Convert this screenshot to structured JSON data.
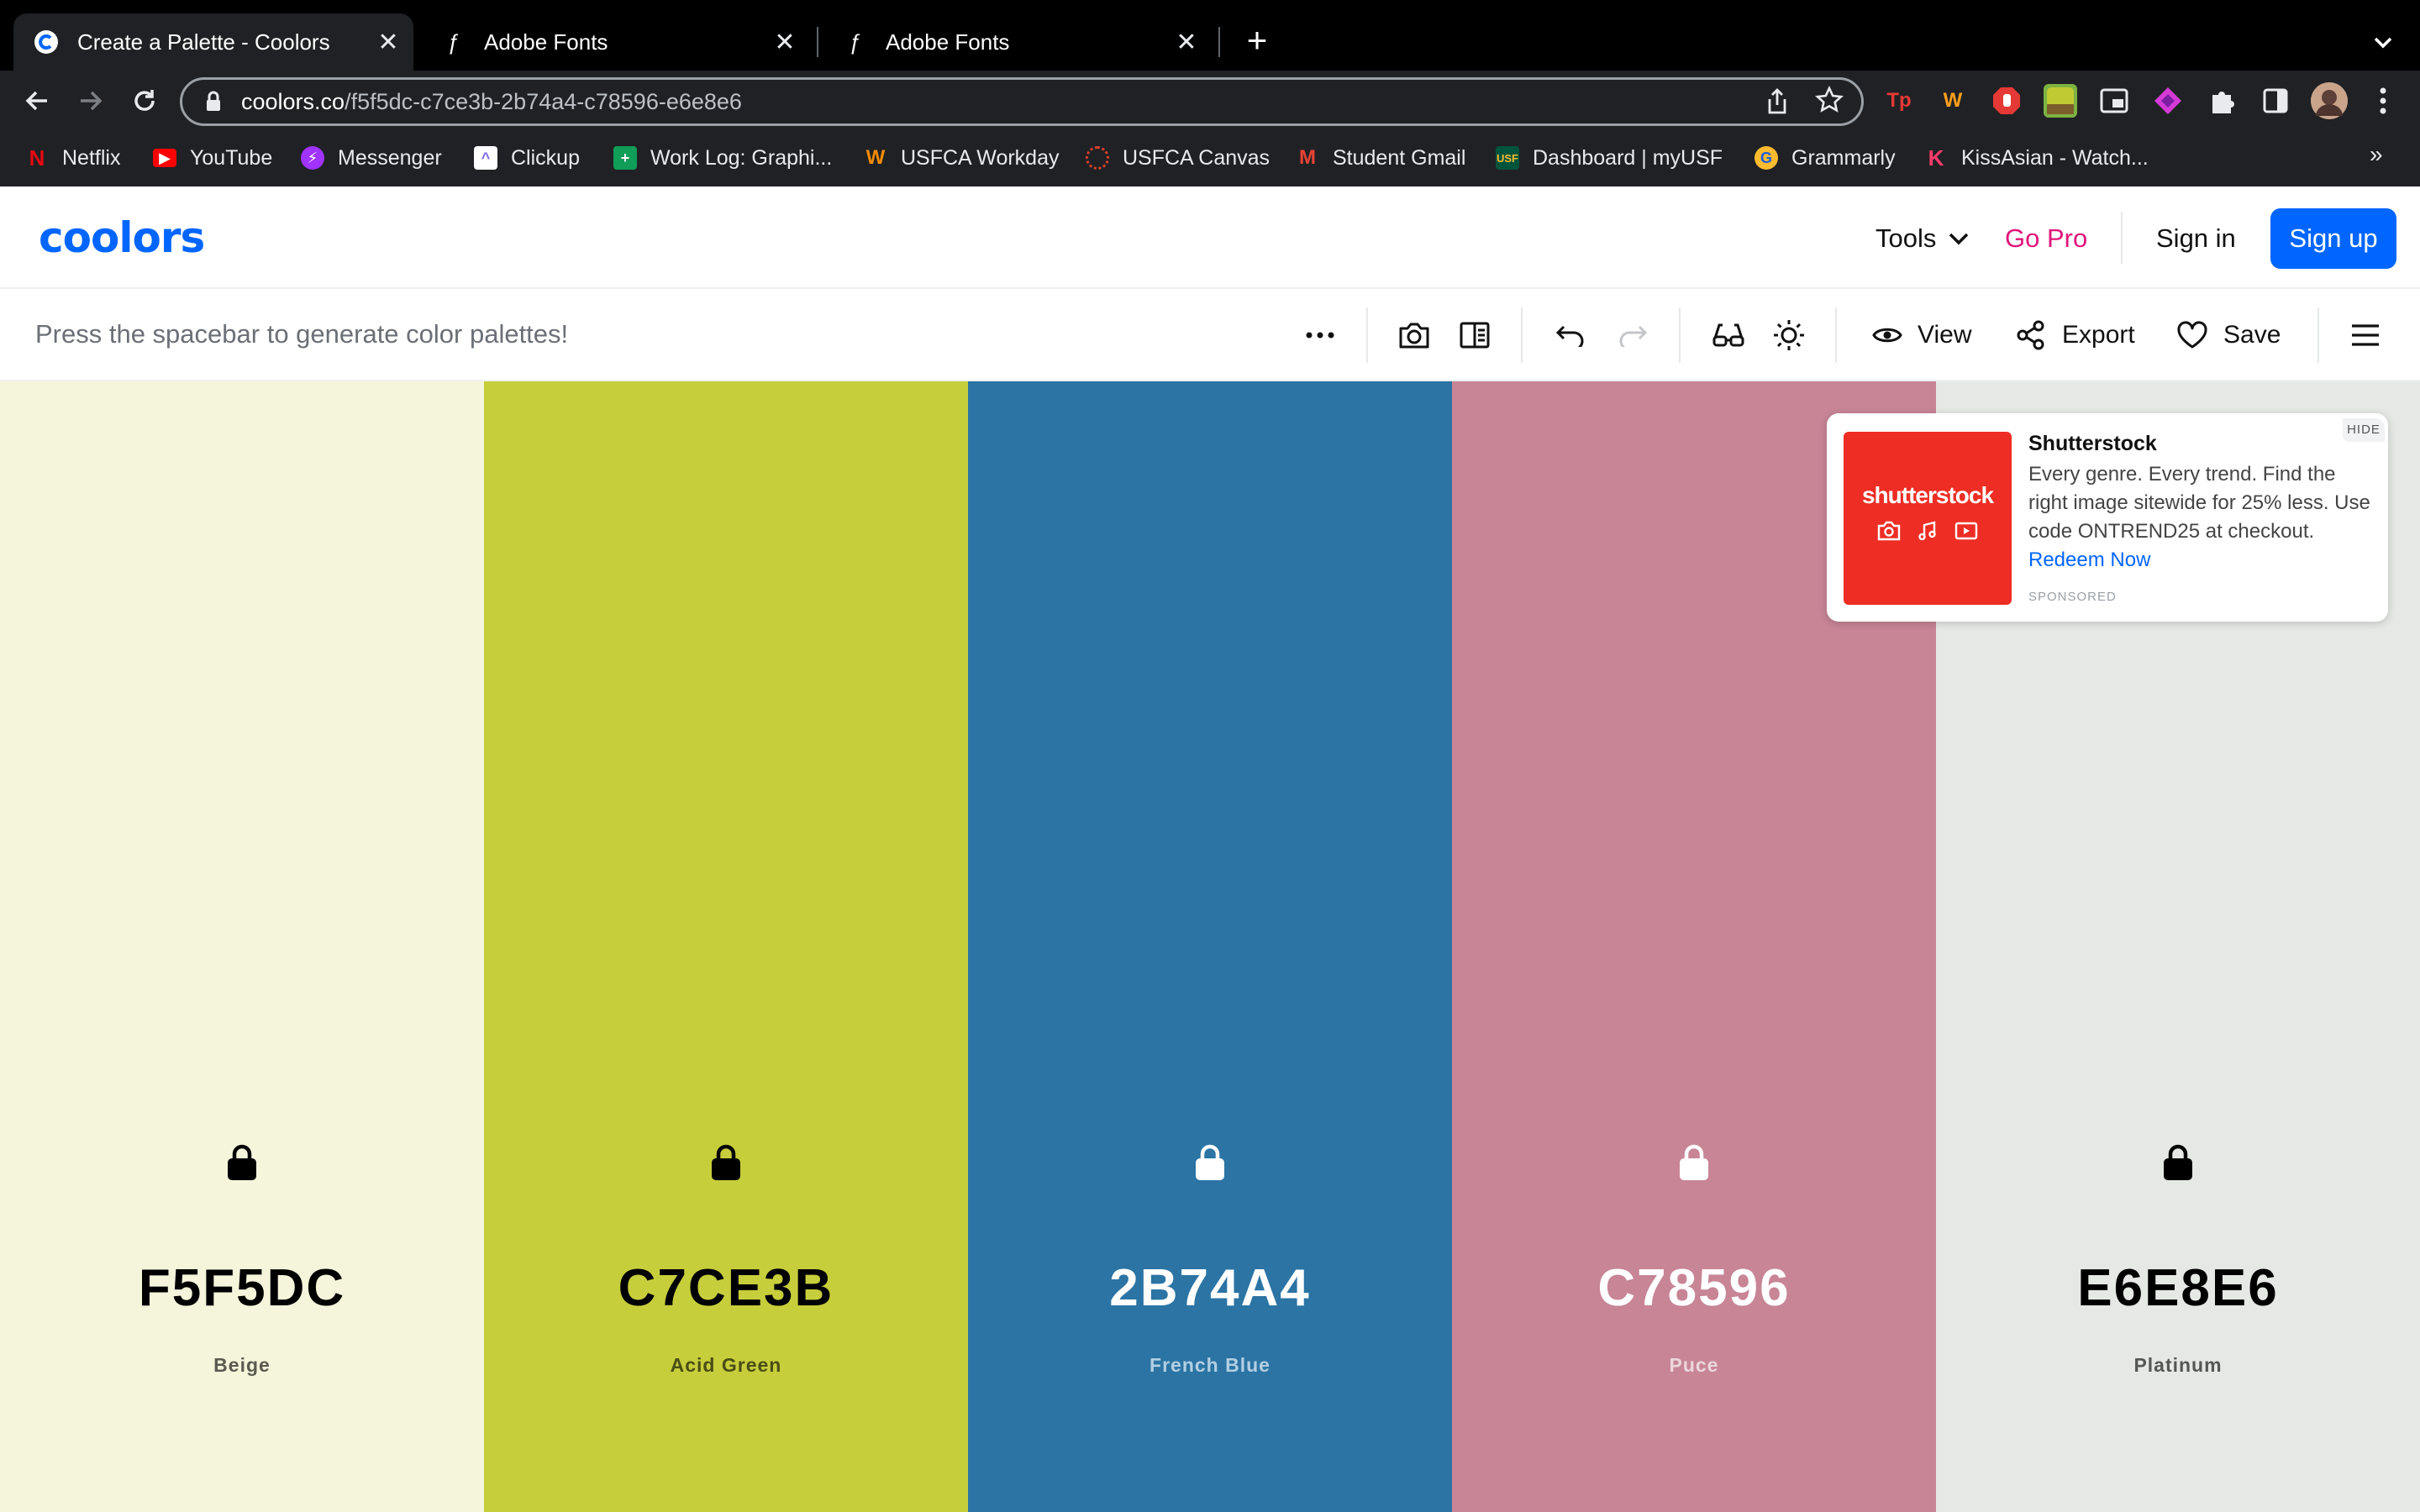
{
  "browser": {
    "tabs": [
      {
        "title": "Create a Palette - Coolors",
        "active": true,
        "icon": "coolors-favicon"
      },
      {
        "title": "Adobe Fonts",
        "active": false,
        "icon": "adobe-fonts-favicon"
      },
      {
        "title": "Adobe Fonts",
        "active": false,
        "icon": "adobe-fonts-favicon"
      }
    ],
    "url_host": "coolors.co",
    "url_path": "/f5f5dc-c7ce3b-2b74a4-c78596-e6e8e6",
    "bookmarks": [
      {
        "label": "Netflix",
        "icon": "netflix-icon",
        "color": "#e50914"
      },
      {
        "label": "YouTube",
        "icon": "youtube-icon",
        "color": "#ff0000"
      },
      {
        "label": "Messenger",
        "icon": "messenger-icon",
        "color": "#a033ff"
      },
      {
        "label": "Clickup",
        "icon": "clickup-icon",
        "color": "#ffffff"
      },
      {
        "label": "Work Log: Graphi...",
        "icon": "sheets-icon",
        "color": "#0f9d58"
      },
      {
        "label": "USFCA Workday",
        "icon": "workday-icon",
        "color": "#f38b00"
      },
      {
        "label": "USFCA Canvas",
        "icon": "canvas-icon",
        "color": "#e13f2b"
      },
      {
        "label": "Student Gmail",
        "icon": "gmail-icon",
        "color": "#ea4335"
      },
      {
        "label": "Dashboard | myUSF",
        "icon": "myusf-icon",
        "color": "#00543c"
      },
      {
        "label": "Grammarly",
        "icon": "grammarly-icon",
        "color": "#15c39a"
      },
      {
        "label": "KissAsian - Watch...",
        "icon": "kissasian-icon",
        "color": "#ff3b6b"
      }
    ],
    "bookmarks_more": "»"
  },
  "header": {
    "logo": "coolors",
    "tools_label": "Tools",
    "gopro_label": "Go Pro",
    "signin_label": "Sign in",
    "signup_label": "Sign up"
  },
  "toolbar": {
    "hint": "Press the spacebar to generate color palettes!",
    "view_label": "View",
    "export_label": "Export",
    "save_label": "Save"
  },
  "palette": [
    {
      "hex": "F5F5DC",
      "name": "Beige",
      "bg": "#f5f5dc",
      "fg": "#000000",
      "sub": "#5a5a4f"
    },
    {
      "hex": "C7CE3B",
      "name": "Acid Green",
      "bg": "#c7ce3b",
      "fg": "#000000",
      "sub": "#4a4d16"
    },
    {
      "hex": "2B74A4",
      "name": "French Blue",
      "bg": "#2b74a4",
      "fg": "#ffffff",
      "sub": "#b3cfe2"
    },
    {
      "hex": "C78596",
      "name": "Puce",
      "bg": "#c78596",
      "fg": "#ffffff",
      "sub": "#ecd7dd"
    },
    {
      "hex": "E6E8E6",
      "name": "Platinum",
      "bg": "#e6e8e6",
      "fg": "#000000",
      "sub": "#555755"
    }
  ],
  "ad": {
    "hide_label": "HIDE",
    "brand_mark": "shutterstock",
    "title": "Shutterstock",
    "body": "Every genre. Every trend. Find the right image sitewide for 25% less. Use code ONTREND25 at checkout.",
    "link": "Redeem Now",
    "sponsored": "SPONSORED"
  },
  "colors": {
    "accent": "#0066ff",
    "gopro": "#e0157a",
    "chrome_bg": "#202124"
  }
}
